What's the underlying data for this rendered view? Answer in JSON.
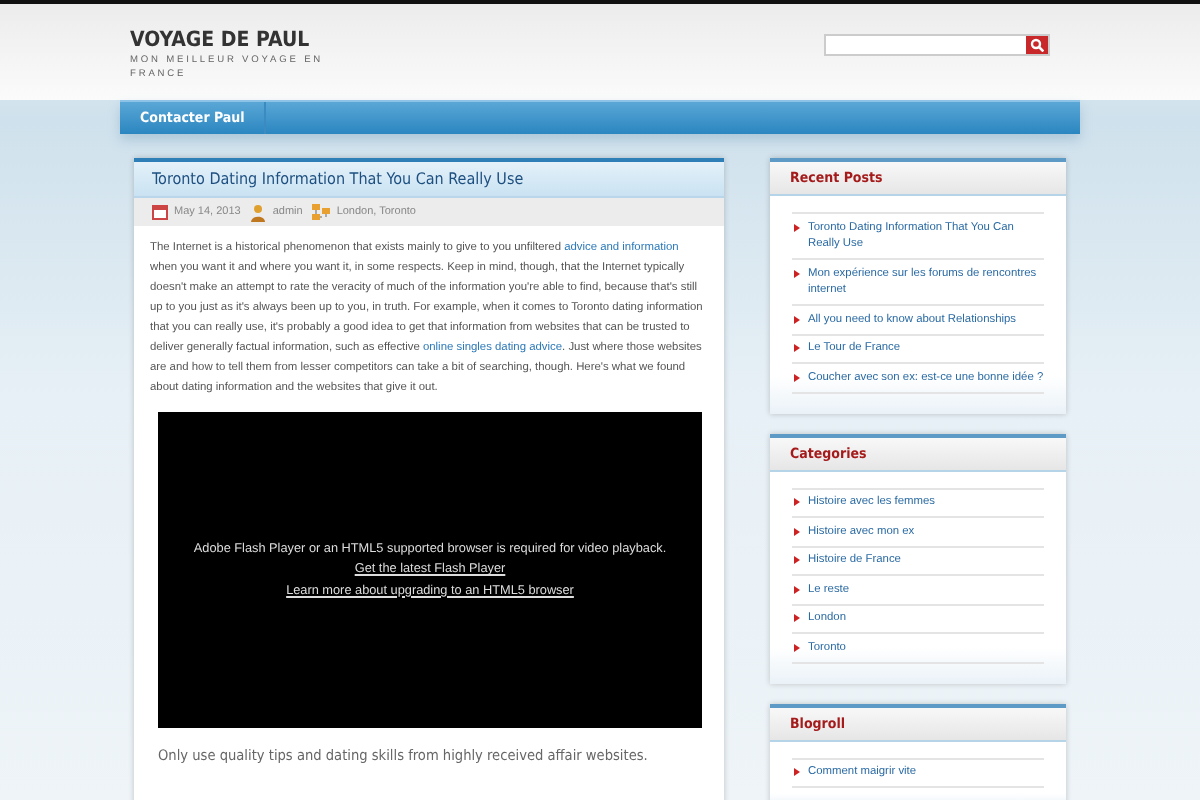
{
  "header": {
    "site_title": "VOYAGE DE PAUL",
    "tagline": "MON MEILLEUR VOYAGE EN FRANCE"
  },
  "nav": [
    {
      "label": "Contacter Paul"
    }
  ],
  "post": {
    "title": "Toronto Dating Information That You Can Really Use",
    "meta": [
      {
        "kind": "date",
        "text": "May 14, 2013"
      },
      {
        "kind": "author",
        "text": "admin"
      },
      {
        "kind": "category",
        "text": "London, Toronto"
      }
    ],
    "intro": [
      {
        "kind": "text",
        "text": "The Internet is a historical phenomenon that exists mainly to give to you unfiltered "
      },
      {
        "kind": "link",
        "text": "advice and information"
      },
      {
        "kind": "text",
        "text": " when you want it and where you want it, in some respects. Keep in mind, though, that the Internet typically doesn't make an attempt to rate the veracity of much of the information you're able to find, because that's still up to you just as it's always been up to you, in truth. For example, when it comes to Toronto dating information that you can really use, it's probably a good idea to get that information from websites that can be trusted to deliver generally factual information, such as effective "
      },
      {
        "kind": "link",
        "text": "online singles dating advice"
      },
      {
        "kind": "text",
        "text": ". Just where those websites are and how to tell them from lesser competitors can take a bit of searching, though. Here's what we found about dating information and the websites that give it out."
      }
    ],
    "video": {
      "message": "Adobe Flash Player or an HTML5 supported browser is required for video playback.",
      "links": [
        "Get the latest Flash Player",
        "Learn more about upgrading to an HTML5 browser"
      ]
    },
    "subheading": "Only use quality tips and dating skills from highly received affair websites."
  },
  "sidebar": [
    {
      "title": "Recent Posts",
      "items": [
        "Toronto Dating Information That You Can Really Use",
        "Mon expérience sur les forums de rencontres internet",
        "All you need to know about Relationships",
        "Le Tour de France",
        "Coucher avec son ex: est-ce une bonne idée ?"
      ]
    },
    {
      "title": "Categories",
      "items": [
        "Histoire avec les femmes",
        "Histoire avec mon ex",
        "Histoire de France",
        "Le reste",
        "London",
        "Toronto"
      ]
    },
    {
      "title": "Blogroll",
      "items": [
        "Comment maigrir vite"
      ]
    }
  ]
}
